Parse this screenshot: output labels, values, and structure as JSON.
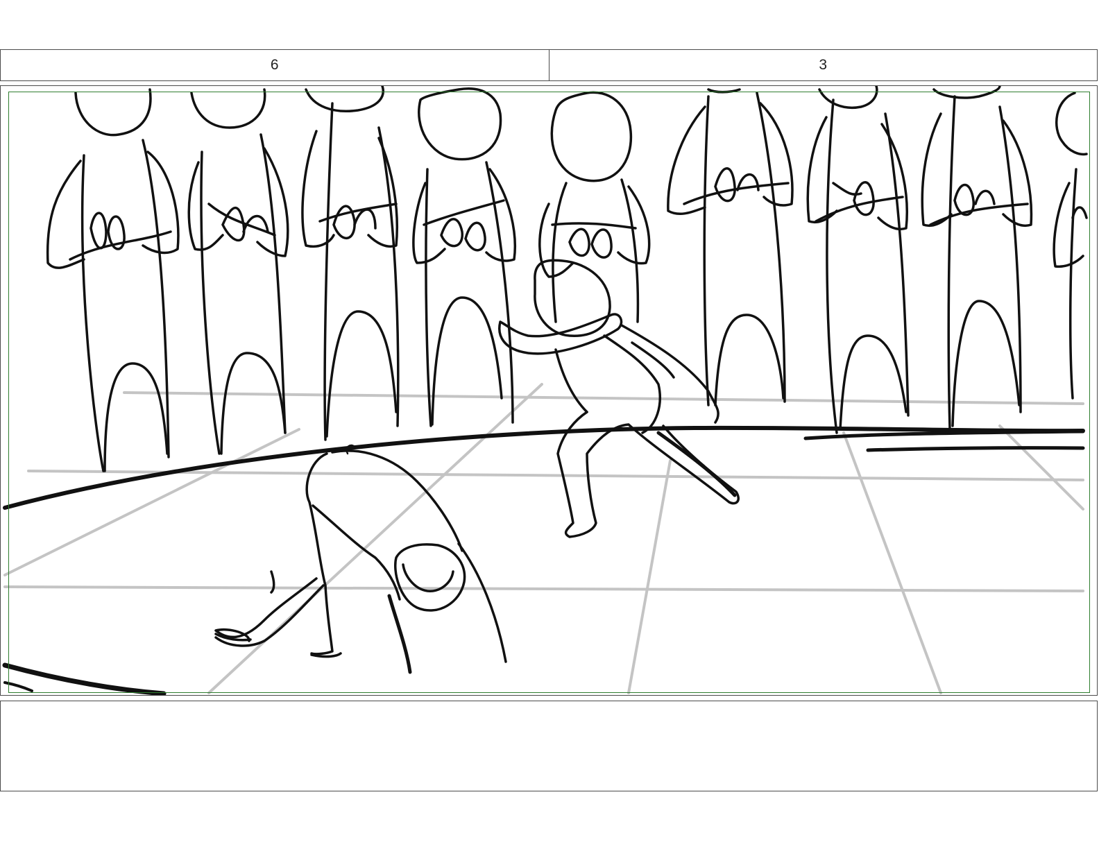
{
  "header": {
    "scene_number": "6",
    "panel_number": "3"
  },
  "panel": {
    "image": "storyboard-sketch",
    "crowd_size": 9,
    "safe_frame_color": "#2e7d2e",
    "line_color": "#111111",
    "grid_color": "#c4c4c4"
  },
  "notes": {
    "text": ""
  }
}
